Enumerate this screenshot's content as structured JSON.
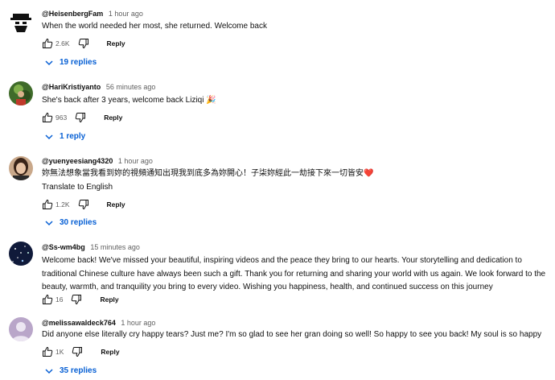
{
  "comments": [
    {
      "author": "@HeisenbergFam",
      "time": "1 hour ago",
      "text": "When the world needed her most, she returned. Welcome back",
      "likes": "2.6K",
      "reply_label": "Reply",
      "replies": "19 replies"
    },
    {
      "author": "@HariKristiyanto",
      "time": "56 minutes ago",
      "text": "She's back after 3 years, welcome back Liziqi 🎉",
      "likes": "963",
      "reply_label": "Reply",
      "replies": "1 reply"
    },
    {
      "author": "@yuenyeesiang4320",
      "time": "1 hour ago",
      "text": "妳無法想象當我看到妳的視頻通知出現我到底多為妳開心！子柒妳經此一劫接下來一切皆安",
      "heart": "❤️",
      "translate": "Translate to English",
      "likes": "1.2K",
      "reply_label": "Reply",
      "replies": "30 replies"
    },
    {
      "author": "@Ss-wm4bg",
      "time": "15 minutes ago",
      "text": "Welcome back! We've missed your beautiful, inspiring videos and the peace they bring to our hearts. Your storytelling and dedication to traditional Chinese culture have always been such a gift. Thank you for returning and sharing your world with us again. We look forward to the beauty, warmth, and tranquility you bring to every video. Wishing you happiness, health, and continued success on this journey",
      "likes": "16",
      "reply_label": "Reply"
    },
    {
      "author": "@melissawaldeck764",
      "time": "1 hour ago",
      "text": "Did anyone else literally cry happy tears? Just me? I'm so glad to see her gran doing so well! So happy to see you back! My soul is so happy",
      "likes": "1K",
      "reply_label": "Reply",
      "replies": "35 replies"
    }
  ],
  "colors": {
    "link": "#065fd4",
    "meta": "#606060",
    "text": "#0f0f0f"
  },
  "icons": [
    "thumbs-up-icon",
    "thumbs-down-icon",
    "chevron-down-icon"
  ]
}
